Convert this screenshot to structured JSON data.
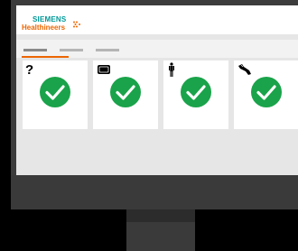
{
  "brand": {
    "line1": "SIEMENS",
    "line2": "Healthineers",
    "color_primary": "#009999",
    "color_accent": "#ec6602"
  },
  "tabs": [
    {
      "label": "",
      "active": true
    },
    {
      "label": "",
      "active": false
    },
    {
      "label": "",
      "active": false
    }
  ],
  "cards": [
    {
      "icon": "question-icon",
      "icon_text": "?",
      "status": "check-icon"
    },
    {
      "icon": "device-icon",
      "icon_text": "",
      "status": "check-icon"
    },
    {
      "icon": "person-icon",
      "icon_text": "",
      "status": "check-icon"
    },
    {
      "icon": "wrench-icon",
      "icon_text": "",
      "status": "check-icon"
    }
  ],
  "colors": {
    "check_green": "#1aa34a",
    "screen_bg": "#e6e6e6",
    "monitor": "#3a3a3a"
  }
}
